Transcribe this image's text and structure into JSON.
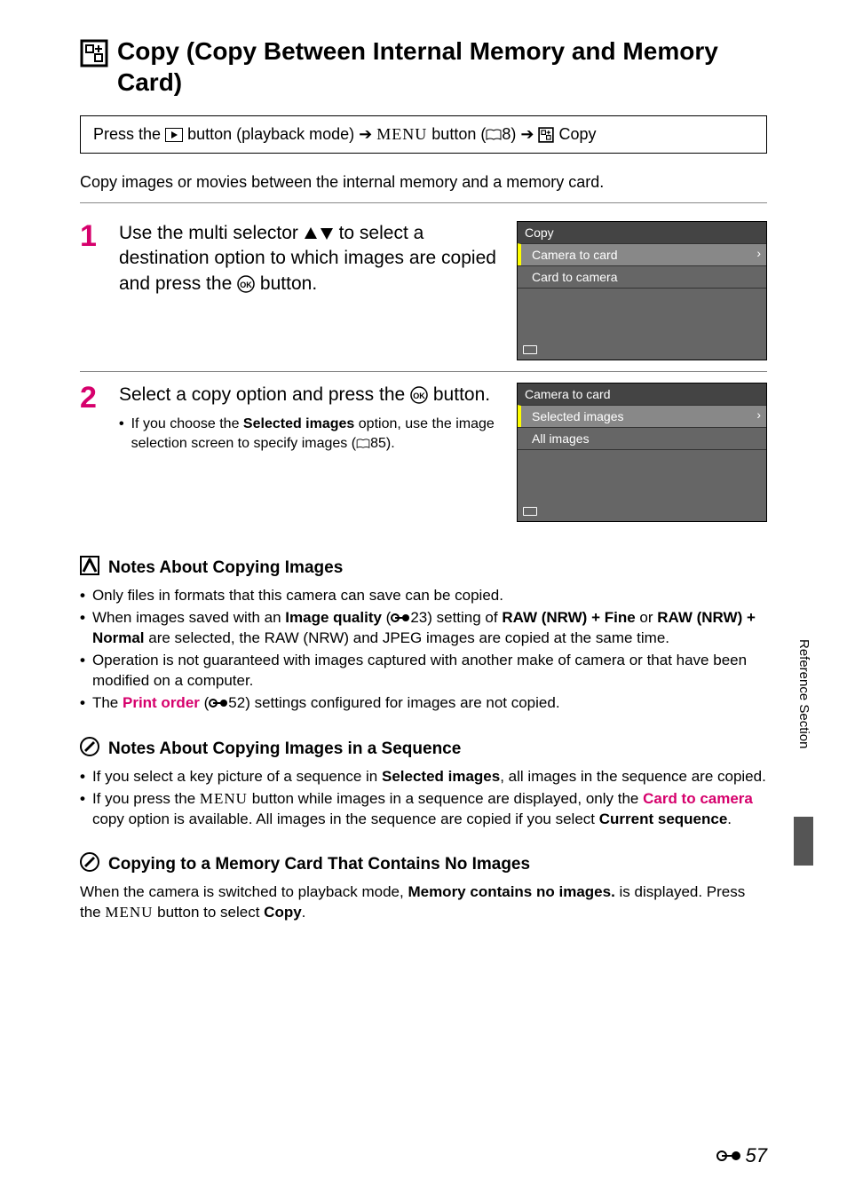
{
  "title_icon": "copy-icon",
  "title": "Copy (Copy Between Internal Memory and Memory Card)",
  "path": {
    "prefix": "Press the ",
    "play_suffix": " button (playback mode) ",
    "arrow": "➔",
    "menu_label": "d",
    "menu_suffix": " button (",
    "book_ref": "8) ",
    "copy_label": " Copy"
  },
  "intro": "Copy images or movies between the internal memory and a memory card.",
  "steps": [
    {
      "num": "1",
      "main_pre": "Use the multi selector ",
      "main_post": " to select a destination option to which images are copied and press the ",
      "main_end": " button.",
      "lcd_title": "Copy",
      "lcd_rows": [
        "Camera to card",
        "Card to camera"
      ]
    },
    {
      "num": "2",
      "main_pre": "Select a copy option and press the ",
      "main_end": " button.",
      "bullet_pre": "If you choose the ",
      "bullet_bold": "Selected images",
      "bullet_post": " option, use the image selection screen to specify images (",
      "bullet_ref": "85).",
      "lcd_title": "Camera to card",
      "lcd_rows": [
        "Selected images",
        "All images"
      ]
    }
  ],
  "notes": [
    {
      "icon": "warn-icon",
      "heading": "Notes About Copying Images",
      "items": [
        {
          "plain": "Only files in formats that this camera can save can be copied."
        },
        {
          "pre": "When images saved with an ",
          "b1": "Image quality",
          "mid1": " (",
          "ref1": "23) setting of ",
          "b2": "RAW (NRW) + Fine",
          "mid2": " or ",
          "b3": "RAW (NRW) + Normal",
          "post": " are selected, the RAW (NRW) and JPEG images are copied at the same time."
        },
        {
          "plain": "Operation is not guaranteed with images captured with another make of camera or that have been modified on a computer."
        },
        {
          "pre": "The ",
          "b1": "Print order",
          "mid1": " (",
          "ref1": "52) settings configured for images are not copied."
        }
      ]
    },
    {
      "icon": "pencil-icon",
      "heading": "Notes About Copying Images in a Sequence",
      "items": [
        {
          "pre": "If you select a key picture of a sequence in ",
          "b1": "Selected images",
          "post": ", all images in the sequence are copied."
        },
        {
          "pre": "If you press the ",
          "menu": "d",
          "mid1": " button while images in a sequence are displayed, only the ",
          "b1": "Card to camera",
          "mid2": " copy option is available. All images in the sequence are copied if you select ",
          "b2": "Current sequence",
          "post": "."
        }
      ]
    },
    {
      "icon": "pencil-icon",
      "heading": "Copying to a Memory Card That Contains No Images",
      "body_pre": "When the camera is switched to playback mode, ",
      "body_b1": "Memory contains no images.",
      "body_mid": " is displayed. Press the ",
      "body_menu": "d",
      "body_mid2": " button to select ",
      "body_b2": "Copy",
      "body_post": "."
    }
  ],
  "side_label": "Reference Section",
  "page_num": "57"
}
